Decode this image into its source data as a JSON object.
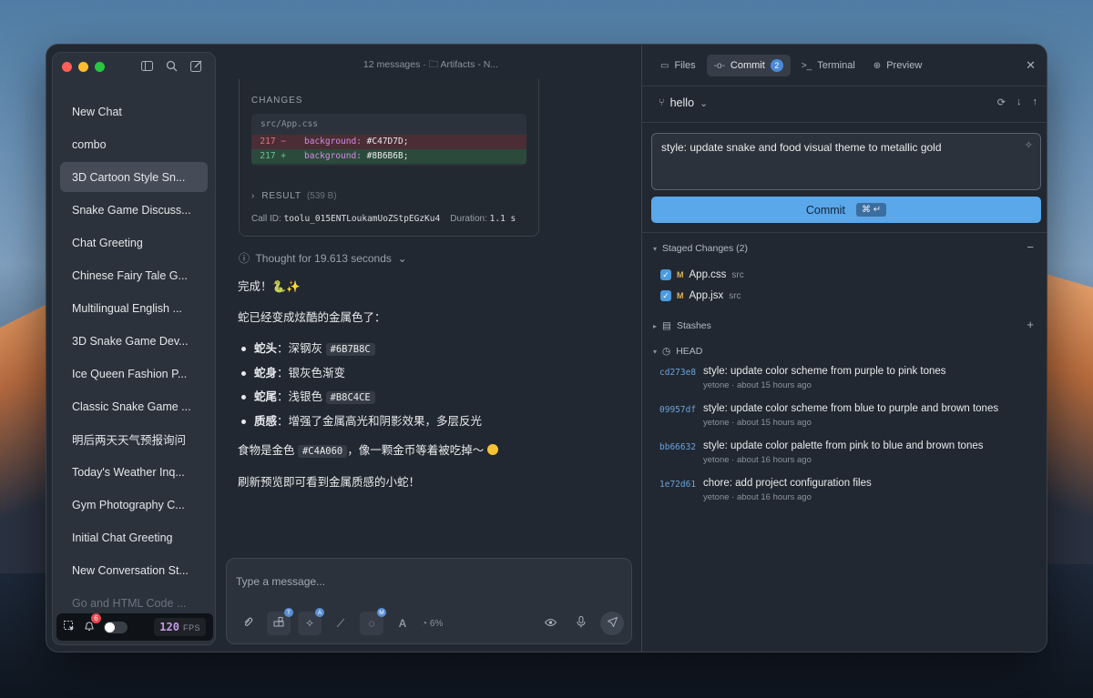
{
  "sidebar": {
    "chats": [
      {
        "label": "New Chat"
      },
      {
        "label": "combo"
      },
      {
        "label": "3D Cartoon Style Sn..."
      },
      {
        "label": "Snake Game Discuss..."
      },
      {
        "label": "Chat Greeting"
      },
      {
        "label": "Chinese Fairy Tale G..."
      },
      {
        "label": "Multilingual English ..."
      },
      {
        "label": "3D Snake Game Dev..."
      },
      {
        "label": "Ice Queen Fashion P..."
      },
      {
        "label": "Classic Snake Game ..."
      },
      {
        "label": "明后两天天气预报询问"
      },
      {
        "label": "Today's Weather Inq..."
      },
      {
        "label": "Gym Photography C..."
      },
      {
        "label": "Initial Chat Greeting"
      },
      {
        "label": "New Conversation St..."
      },
      {
        "label": "Go and HTML Code ..."
      }
    ],
    "notifications_count": "6",
    "fps_value": "120",
    "fps_label": "FPS"
  },
  "chat": {
    "header": "12 messages · 🗀 Artifacts - N...",
    "tool": {
      "changes_label": "CHANGES",
      "file": "src/App.css",
      "del_line": "217 −",
      "del_prop": "background:",
      "del_val": "#C47D7D;",
      "add_line": "217 +",
      "add_prop": "background:",
      "add_val": "#8B6B6B;",
      "result_label": "RESULT",
      "result_size": "(539 B)",
      "callid_label": "Call ID:",
      "callid_value": "toolu_015ENTLoukamUoZStpEGzKu4",
      "duration_label": "Duration:",
      "duration_value": "1.1 s"
    },
    "thought": "Thought for 19.613 seconds",
    "message": {
      "done": "完成！🐍✨",
      "intro": "蛇已经变成炫酷的金属色了：",
      "items": [
        {
          "key": "蛇头",
          "text": "：深钢灰 ",
          "code": "#6B7B8C"
        },
        {
          "key": "蛇身",
          "text": "：银灰色渐变",
          "code": ""
        },
        {
          "key": "蛇尾",
          "text": "：浅银色 ",
          "code": "#B8C4CE"
        },
        {
          "key": "质感",
          "text": "：增强了金属高光和阴影效果，多层反光",
          "code": ""
        }
      ],
      "food_pre": "食物是金色 ",
      "food_code": "#C4A060",
      "food_post": "，像一颗金币等着被吃掉～ ",
      "outro": "刷新预览即可看到金属质感的小蛇！"
    },
    "composer": {
      "placeholder": "Type a message...",
      "context_pct": "6%",
      "badge_t": "T",
      "badge_a": "A",
      "badge_m": "M"
    }
  },
  "panel": {
    "tabs": [
      {
        "label": "Files"
      },
      {
        "label": "Commit",
        "count": "2"
      },
      {
        "label": "Terminal"
      },
      {
        "label": "Preview"
      }
    ],
    "branch": "hello",
    "commit_message": "style: update snake and food visual theme to metallic gold",
    "commit_button": "Commit",
    "commit_shortcut": "⌘ ↵",
    "staged_label": "Staged Changes (2)",
    "staged_files": [
      {
        "flag": "M",
        "name": "App.css",
        "dir": "src"
      },
      {
        "flag": "M",
        "name": "App.jsx",
        "dir": "src"
      }
    ],
    "stashes_label": "Stashes",
    "head_label": "HEAD",
    "commits": [
      {
        "hash": "cd273e8",
        "message": "style: update color scheme from purple to pink tones",
        "author": "yetone",
        "time": "about 15 hours ago"
      },
      {
        "hash": "09957df",
        "message": "style: update color scheme from blue to purple and brown tones",
        "author": "yetone",
        "time": "about 15 hours ago"
      },
      {
        "hash": "bb66632",
        "message": "style: update color palette from pink to blue and brown tones",
        "author": "yetone",
        "time": "about 16 hours ago"
      },
      {
        "hash": "1e72d61",
        "message": "chore: add project configuration files",
        "author": "yetone",
        "time": "about 16 hours ago"
      }
    ]
  },
  "colors": {
    "accent": "#5aa7ea",
    "window_bg": "#222831",
    "diff_del": "#4a2d35",
    "diff_add": "#2c4a3c"
  }
}
